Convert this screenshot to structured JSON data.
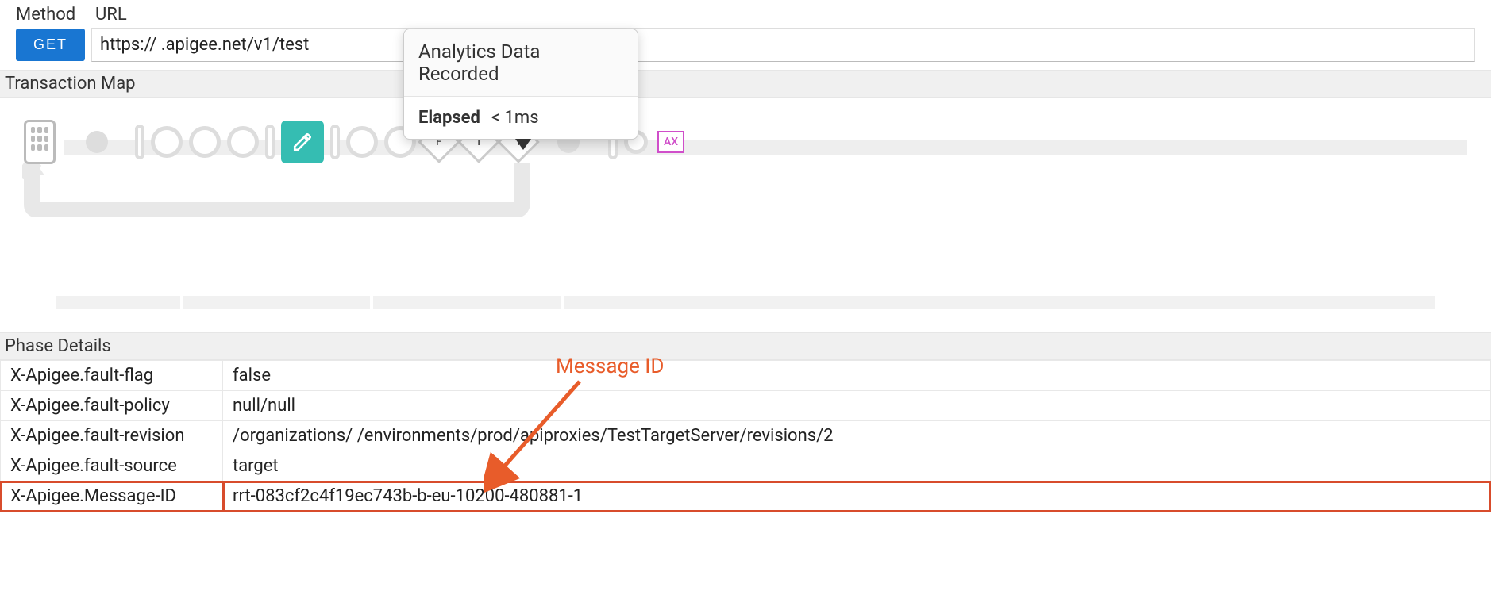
{
  "labels": {
    "method": "Method",
    "url": "URL"
  },
  "request": {
    "method_button": "GET",
    "url_display": "https://                     .apigee.net/v1/test"
  },
  "transaction_map": {
    "title": "Transaction Map",
    "flow_letters": [
      "F",
      "T",
      "T"
    ],
    "ax_label": "AX"
  },
  "tooltip": {
    "title": "Analytics Data Recorded",
    "elapsed_label": "Elapsed",
    "elapsed_value": "< 1ms"
  },
  "phase_details": {
    "title": "Phase Details",
    "rows": [
      {
        "k": "X-Apigee.fault-flag",
        "v": "false"
      },
      {
        "k": "X-Apigee.fault-policy",
        "v": "null/null"
      },
      {
        "k": "X-Apigee.fault-revision",
        "v": "/organizations/            /environments/prod/apiproxies/TestTargetServer/revisions/2"
      },
      {
        "k": "X-Apigee.fault-source",
        "v": "target"
      },
      {
        "k": "X-Apigee.Message-ID",
        "v": "rrt-083cf2c4f19ec743b-b-eu-10200-480881-1"
      }
    ]
  },
  "annotation": {
    "text": "Message ID"
  }
}
